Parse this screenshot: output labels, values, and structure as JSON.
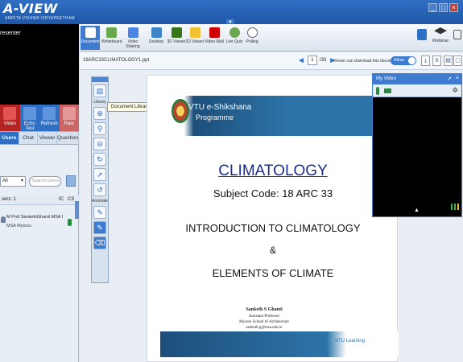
{
  "window": {
    "app_name": "A-VIEW",
    "app_subtitle": "AMRITA VISHWA VIDYAPEETHAM",
    "buttons": [
      "_",
      "□",
      "×"
    ],
    "collapse_glyph": "▼"
  },
  "left_panel": {
    "presenter_label": "resenter",
    "actions": [
      {
        "label": "Video",
        "icon": "video-icon"
      },
      {
        "label": "Echo Test",
        "icon": "echo-test-icon"
      },
      {
        "label": "Refresh",
        "icon": "refresh-icon"
      },
      {
        "label": "Rais",
        "icon": "raise-hand-icon"
      }
    ],
    "tabs": [
      "Users",
      "Chat",
      "Viewer",
      "Question"
    ],
    "active_tab": "Users",
    "filter_select": "All",
    "search_placeholder": "-Search Users-",
    "users_count_label": "sers: 1",
    "col_ic": "IC",
    "col_cs": "CS",
    "user": {
      "name": "M Prof SankethGhanti MSA I",
      "sub": "MSA Mysuru"
    }
  },
  "toolbar": {
    "tools": [
      {
        "label": "Document",
        "icon": "document-icon"
      },
      {
        "label": "Whiteboard",
        "icon": "whiteboard-icon"
      },
      {
        "label": "Video Sharing",
        "icon": "video-sharing-icon"
      },
      {
        "label": "Desktop",
        "icon": "desktop-icon"
      },
      {
        "label": "3D Viewer",
        "icon": "3d-viewer-icon"
      },
      {
        "label": "2D Viewer",
        "icon": "2d-viewer-icon"
      },
      {
        "label": "Video Wall",
        "icon": "video-wall-icon"
      },
      {
        "label": "Live Quiz",
        "icon": "live-quiz-icon"
      },
      {
        "label": "Polling",
        "icon": "polling-icon"
      }
    ],
    "active_tool": "Document",
    "webinar_label": "Webinar"
  },
  "docbar": {
    "document_name": "18ARC33CLIMATOLOGY1.ppt",
    "current_page": "1",
    "total_pages": "/33",
    "download_note": "Viewer can download this document",
    "allow_label": "Allow",
    "buttons": [
      "⤓",
      "X",
      "▤",
      "▢"
    ]
  },
  "palette": {
    "library_label": "Library",
    "annotate_label": "Annotate",
    "tooltip": "Document Library"
  },
  "slide": {
    "brand_line1": "VTU e-Shikshana",
    "brand_line2": "Programme",
    "title": "CLIMATOLOGY",
    "subject": "Subject Code: 18 ARC 33",
    "intro": "INTRODUCTION TO CLIMATOLOGY",
    "amp": "&",
    "elements": "ELEMENTS OF CLIMATE",
    "author": "Sanketh S Ghanti",
    "role": "Assistant  Professor",
    "school": "Mysore School of Architecture",
    "email": "sanketh.g@msa.edu.in",
    "footer_logo": "VTU Learning"
  },
  "my_video": {
    "title": "My Video",
    "expand_glyph": "▲"
  },
  "colors": {
    "accent": "#2f6fc4",
    "title_blue": "#1b2b8f",
    "video_bg": "#000000"
  }
}
